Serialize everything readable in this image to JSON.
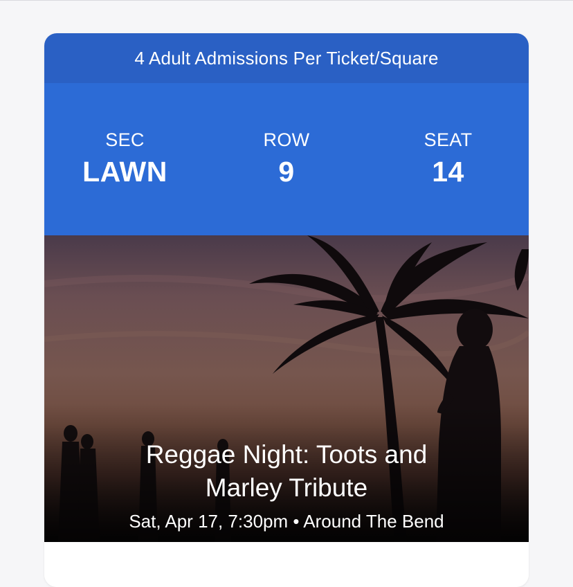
{
  "ticket": {
    "admissions_text": "4 Adult Admissions Per Ticket/Square",
    "seat": {
      "sec_label": "SEC",
      "sec_value": "LAWN",
      "row_label": "ROW",
      "row_value": "9",
      "seat_label": "SEAT",
      "seat_value": "14"
    },
    "event": {
      "title": "Reggae Night: Toots and Marley Tribute",
      "date_time": "Sat, Apr 17, 7:30pm",
      "separator": "•",
      "venue": "Around The Bend"
    },
    "colors": {
      "admission_bar": "#2a60c4",
      "seat_panel": "#2c6bd6"
    }
  }
}
